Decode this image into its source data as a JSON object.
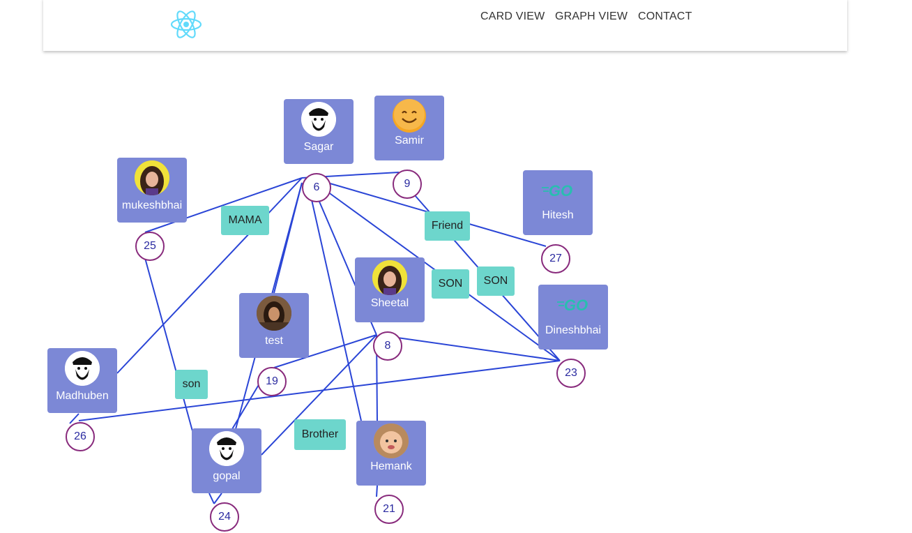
{
  "nav": {
    "logo_icon": "react-atom-icon",
    "links": [
      "CARD VIEW",
      "GRAPH VIEW",
      "CONTACT"
    ]
  },
  "colors": {
    "node": "#7c88d6",
    "edge": "#2a45d6",
    "circle_border": "#882a7c",
    "relation": "#6dd6cc"
  },
  "people": {
    "sagar": {
      "name": "Sagar",
      "icon": "bearded-man-avatar"
    },
    "samir": {
      "name": "Samir",
      "icon": "smiley-emoji-avatar"
    },
    "mukeshbhai": {
      "name": "mukeshbhai",
      "icon": "girl-photo-avatar"
    },
    "hitesh": {
      "name": "Hitesh",
      "icon": "go-gopher-icon"
    },
    "sheetal": {
      "name": "Sheetal",
      "icon": "girl-photo-avatar"
    },
    "test": {
      "name": "test",
      "icon": "woman-photo-avatar"
    },
    "dineshbhai": {
      "name": "Dineshbhai",
      "icon": "go-gopher-icon"
    },
    "madhuben": {
      "name": "Madhuben",
      "icon": "bearded-man-avatar"
    },
    "gopal": {
      "name": "gopal",
      "icon": "bearded-man-avatar"
    },
    "hemank": {
      "name": "Hemank",
      "icon": "baby-photo-avatar"
    }
  },
  "connectors": {
    "c6": "6",
    "c9": "9",
    "c25": "25",
    "c27": "27",
    "c8": "8",
    "c19": "19",
    "c23": "23",
    "c26": "26",
    "c24": "24",
    "c21": "21"
  },
  "relations": {
    "mama": "MAMA",
    "friend": "Friend",
    "son1": "SON",
    "son2": "SON",
    "son3": "son",
    "brother": "Brother"
  }
}
